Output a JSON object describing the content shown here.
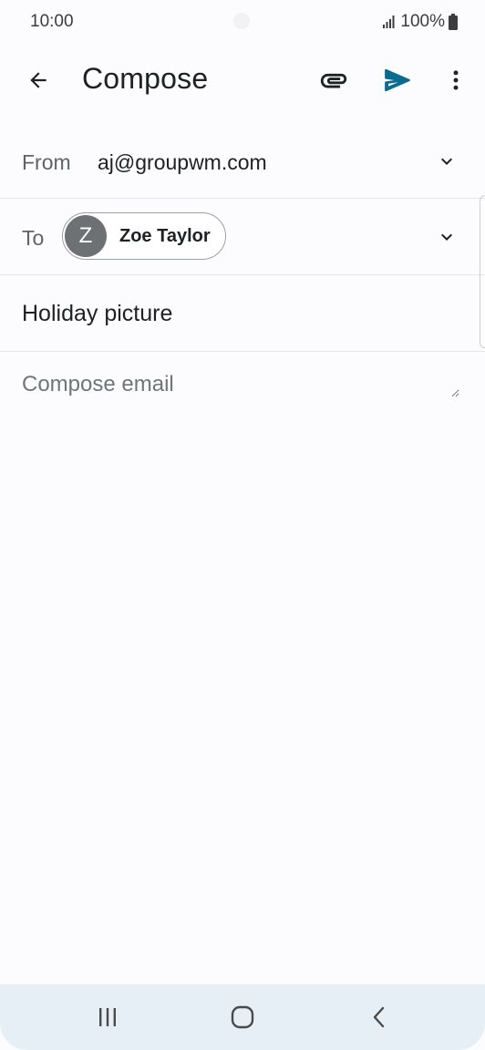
{
  "status_bar": {
    "time": "10:00",
    "battery": "100%",
    "icons": [
      "signal-icon",
      "battery-icon"
    ]
  },
  "app_bar": {
    "title": "Compose",
    "icons": [
      "back-arrow-icon",
      "paperclip-icon",
      "send-icon",
      "more-vert-icon"
    ]
  },
  "from": {
    "label": "From",
    "value": "aj@groupwm.com"
  },
  "to": {
    "label": "To",
    "recipient": {
      "initial": "Z",
      "name": "Zoe Taylor"
    }
  },
  "subject": {
    "value": "Holiday picture"
  },
  "body": {
    "placeholder": "Compose email",
    "value": ""
  },
  "nav_bar": {
    "icons": [
      "recents-icon",
      "home-icon",
      "nav-back-icon"
    ]
  },
  "colors": {
    "accent": "#1a73e8",
    "send_icon": "#0b6b8f",
    "text_primary": "#202124",
    "text_secondary": "#5f6368",
    "avatar_bg": "#6e7174",
    "nav_bar_bg": "#e6eef6",
    "divider": "#e6e6ea"
  }
}
